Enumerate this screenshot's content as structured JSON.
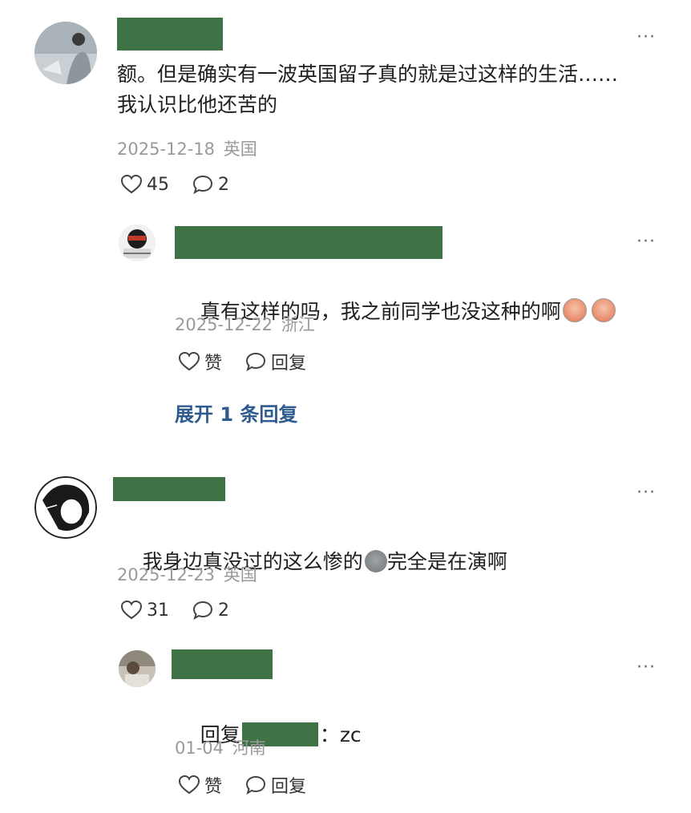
{
  "comments": [
    {
      "text": "额。但是确实有一波英国留子真的就是过这样的生活……我认识比他还苦的",
      "date": "2025-12-18",
      "location": "英国",
      "likes": "45",
      "replies": "2",
      "more": "···"
    },
    {
      "text": "真有这样的吗，我之前同学也没这种的啊",
      "date": "2025-12-22",
      "location": "浙江",
      "like_label": "赞",
      "reply_label": "回复",
      "more": "···",
      "expand_label": "展开 1 条回复"
    },
    {
      "text_a": "我身边真没过的这么惨的",
      "text_b": "完全是在演啊",
      "date": "2025-12-23",
      "location": "英国",
      "likes": "31",
      "replies": "2",
      "more": "···"
    },
    {
      "reply_prefix": "回复",
      "reply_suffix": "：zc",
      "date": "01-04",
      "location": "河南",
      "like_label": "赞",
      "reply_label": "回复",
      "more": "···"
    }
  ],
  "colors": {
    "redaction": "#3f7244",
    "link": "#2f5a8f",
    "meta": "#9a9a9a"
  }
}
